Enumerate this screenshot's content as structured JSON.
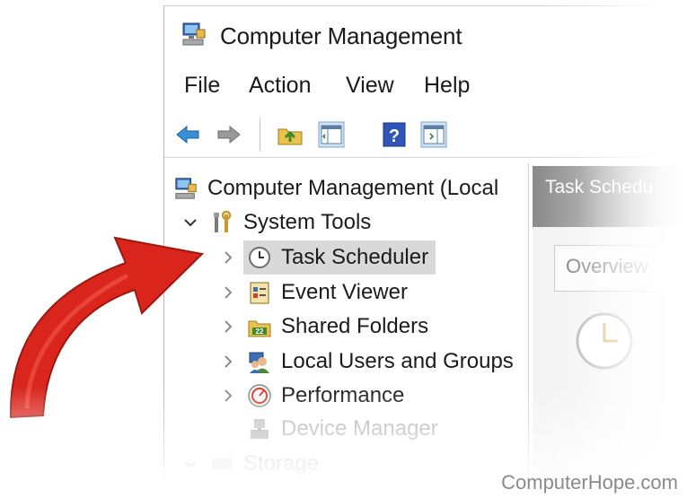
{
  "window": {
    "title": "Computer Management",
    "title_icon": "computer-management-icon"
  },
  "menubar": {
    "file": "File",
    "action": "Action",
    "view": "View",
    "help": "Help"
  },
  "toolbar": {
    "icons": [
      "back-arrow-icon",
      "forward-arrow-icon",
      "up-folder-icon",
      "show-hide-console-tree-icon",
      "help-icon",
      "show-hide-action-pane-icon"
    ]
  },
  "tree": {
    "root": {
      "label": "Computer Management (Local"
    },
    "system_tools": {
      "label": "System Tools"
    },
    "items": [
      {
        "label": "Task Scheduler",
        "icon": "clock-icon",
        "selected": true
      },
      {
        "label": "Event Viewer",
        "icon": "event-viewer-icon"
      },
      {
        "label": "Shared Folders",
        "icon": "shared-folders-icon"
      },
      {
        "label": "Local Users and Groups",
        "icon": "users-icon"
      },
      {
        "label": "Performance",
        "icon": "performance-icon"
      },
      {
        "label": "Device Manager",
        "icon": "device-manager-icon"
      }
    ],
    "storage": {
      "label": "Storage"
    }
  },
  "right_pane": {
    "header": "Task Schedu",
    "tab": "Overview"
  },
  "annotation": {
    "arrow_color": "#d9251c"
  },
  "watermark": "ComputerHope.com"
}
